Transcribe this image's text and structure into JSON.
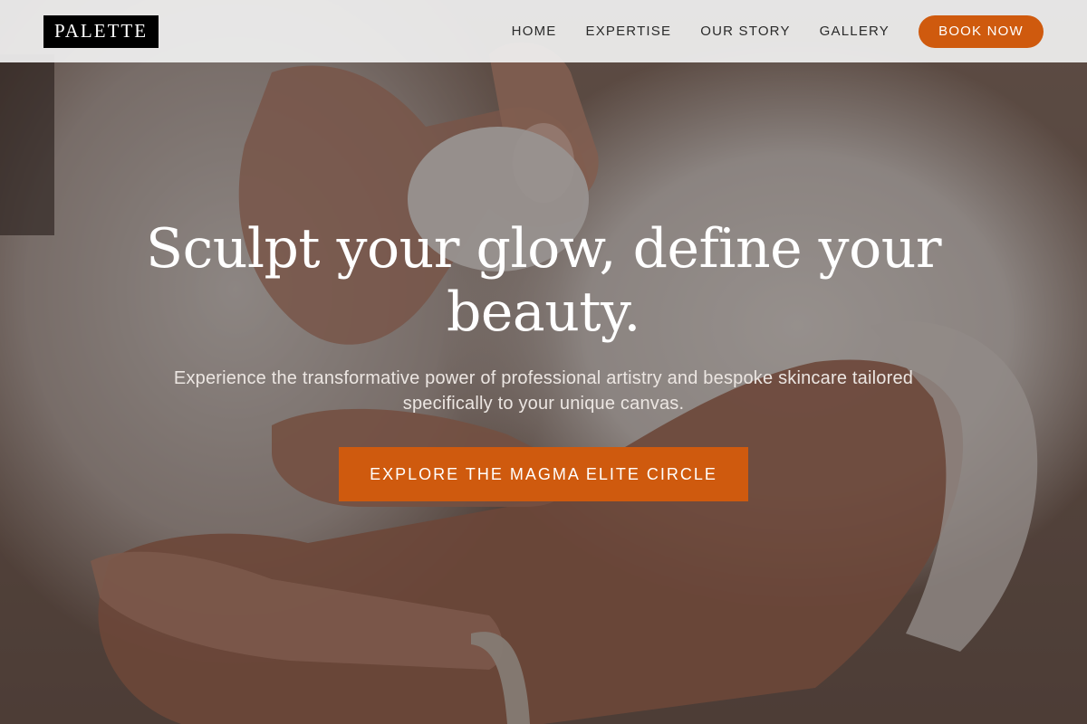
{
  "brand": {
    "logo_text": "PALETTE"
  },
  "nav": {
    "links": [
      "HOME",
      "EXPERTISE",
      "OUR STORY",
      "GALLERY"
    ],
    "book_label": "BOOK NOW"
  },
  "hero": {
    "headline": "Sculpt your glow, define your beauty.",
    "subtext": "Experience the transformative power of professional artistry and bespoke skincare tailored specifically to your unique canvas.",
    "cta_label": "EXPLORE THE MAGMA ELITE CIRCLE"
  },
  "colors": {
    "accent": "#cf5a0e",
    "nav_bg": "#f0f0f0",
    "logo_bg": "#000000"
  }
}
